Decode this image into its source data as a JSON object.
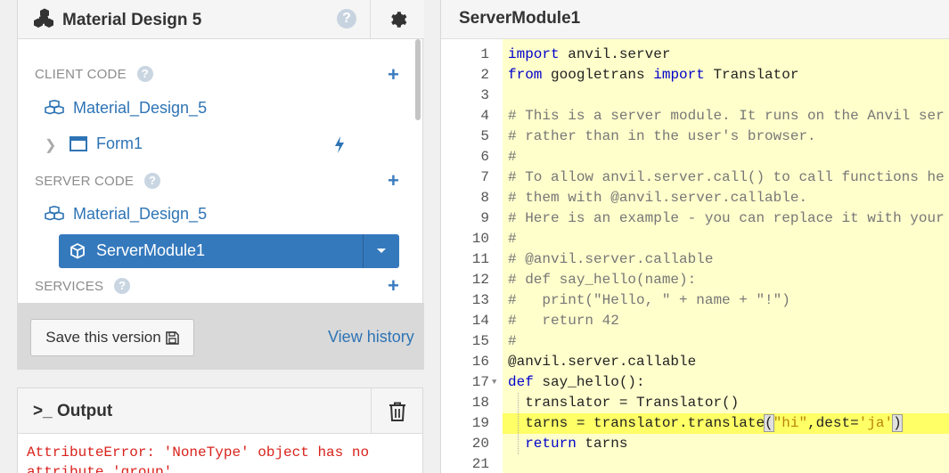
{
  "app": {
    "title": "Material Design 5",
    "help_glyph": "?",
    "icons": {
      "app": "cubes-icon",
      "settings": "gear-icon"
    }
  },
  "tree": {
    "client_code_label": "CLIENT CODE",
    "server_code_label": "SERVER CODE",
    "services_label": "SERVICES",
    "add_glyph": "+",
    "help_glyph": "?",
    "client_package": "Material_Design_5",
    "form": "Form1",
    "server_package": "Material_Design_5",
    "server_module": "ServerModule1"
  },
  "footer": {
    "save_label": "Save this version",
    "history_label": "View history"
  },
  "output": {
    "title": ">_ Output",
    "text": "AttributeError: 'NoneType' object has no attribute 'group'"
  },
  "editor": {
    "title": "ServerModule1",
    "lines": [
      "import anvil.server",
      "from googletrans import Translator",
      "",
      "# This is a server module. It runs on the Anvil ser",
      "# rather than in the user's browser.",
      "#",
      "# To allow anvil.server.call() to call functions he",
      "# them with @anvil.server.callable.",
      "# Here is an example - you can replace it with your",
      "#",
      "# @anvil.server.callable",
      "# def say_hello(name):",
      "#   print(\"Hello, \" + name + \"!\")",
      "#   return 42",
      "#",
      "@anvil.server.callable",
      "def say_hello():",
      "  translator = Translator()",
      "  tarns = translator.translate(\"hi\",dest='ja')",
      "  return tarns",
      ""
    ],
    "line_numbers": [
      "1",
      "2",
      "3",
      "4",
      "5",
      "6",
      "7",
      "8",
      "9",
      "10",
      "11",
      "12",
      "13",
      "14",
      "15",
      "16",
      "17",
      "18",
      "19",
      "20",
      "21"
    ]
  }
}
